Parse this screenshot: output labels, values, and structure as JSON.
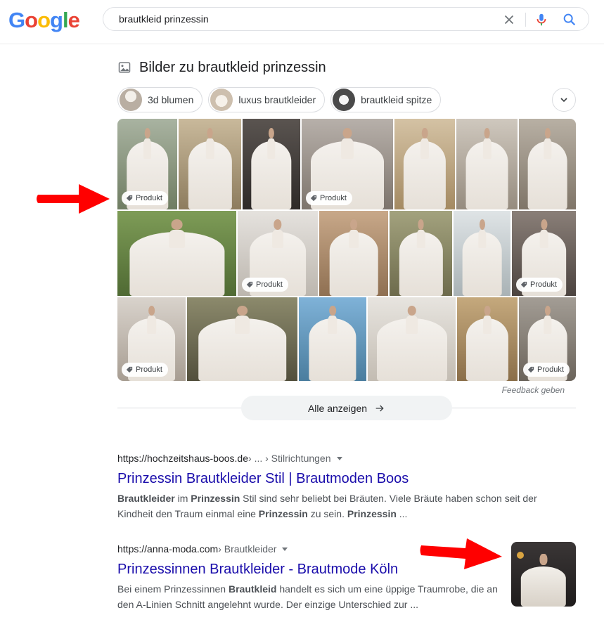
{
  "logo": {
    "letters": [
      "G",
      "o",
      "o",
      "g",
      "l",
      "e"
    ],
    "colors": [
      "#4285F4",
      "#EA4335",
      "#FBBC05",
      "#4285F4",
      "#34A853",
      "#EA4335"
    ]
  },
  "search": {
    "query": "brautkleid prinzessin"
  },
  "images": {
    "heading": "Bilder zu brautkleid prinzessin",
    "chips": [
      {
        "label": "3d blumen"
      },
      {
        "label": "luxus brautkleider"
      },
      {
        "label": "brautkleid spitze"
      }
    ],
    "badge_label": "Produkt",
    "feedback": "Feedback geben",
    "show_all": "Alle anzeigen"
  },
  "results": [
    {
      "url": "https://hochzeitshaus-boos.de",
      "path": " › ... › Stilrichtungen",
      "title": "Prinzessin Brautkleider Stil | Brautmoden Boos",
      "snippet_html": "<b>Brautkleider</b> im <b>Prinzessin</b> Stil sind sehr beliebt bei Bräuten. Viele Bräute haben schon seit der Kindheit den Traum einmal eine <b>Prinzessin</b> zu sein. <b>Prinzessin</b> ..."
    },
    {
      "url": "https://anna-moda.com",
      "path": " › Brautkleider",
      "title": "Prinzessinnen Brautkleider - Brautmode Köln",
      "snippet_html": "Bei einem Prinzessinnen <b>Brautkleid</b> handelt es sich um eine üppige Traumrobe, die an den A-Linien Schnitt angelehnt wurde. Der einzige Unterschied zur ..."
    }
  ],
  "colors": {
    "arrow": "#ff0000",
    "link": "#1a0dab"
  }
}
